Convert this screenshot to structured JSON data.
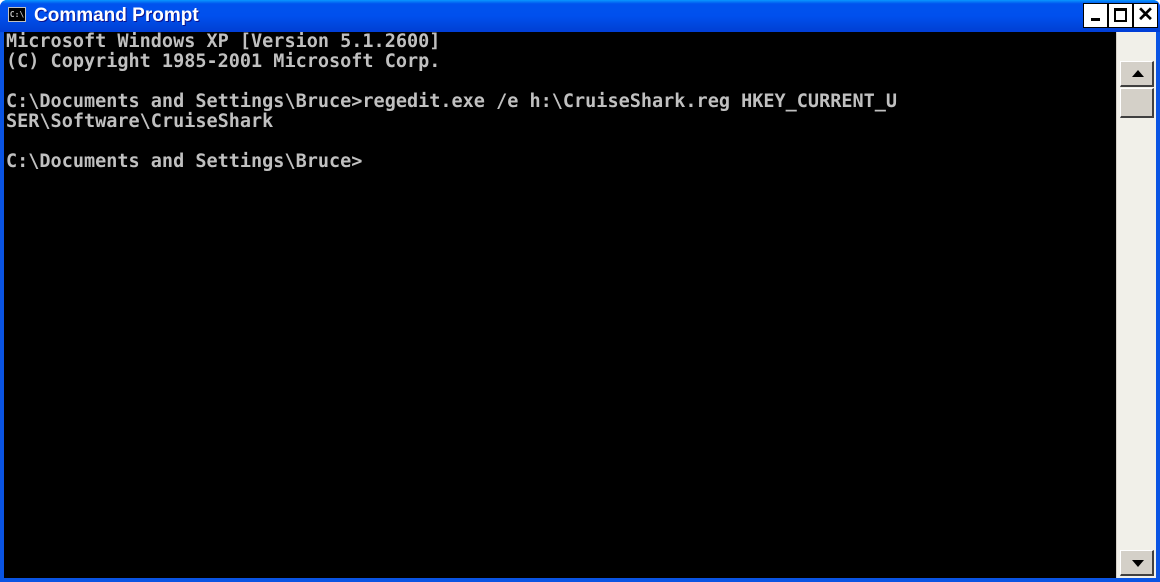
{
  "window": {
    "title": "Command Prompt",
    "icon_label": "C:\\",
    "icon": "console-icon",
    "controls": {
      "minimize": "minimize-icon",
      "maximize": "maximize-icon",
      "close": "close-icon",
      "close_glyph": "✕"
    }
  },
  "console": {
    "text": "Microsoft Windows XP [Version 5.1.2600]\n(C) Copyright 1985-2001 Microsoft Corp.\n\nC:\\Documents and Settings\\Bruce>regedit.exe /e h:\\CruiseShark.reg HKEY_CURRENT_U\nSER\\Software\\CruiseShark\n\nC:\\Documents and Settings\\Bruce>",
    "foreground": "#c0c0c0",
    "background": "#000000"
  },
  "scrollbar": {
    "up": "scroll-up-arrow-icon",
    "down": "scroll-down-arrow-icon"
  },
  "colors": {
    "titlebar": "#0053ee",
    "title_text": "#ffffff"
  }
}
